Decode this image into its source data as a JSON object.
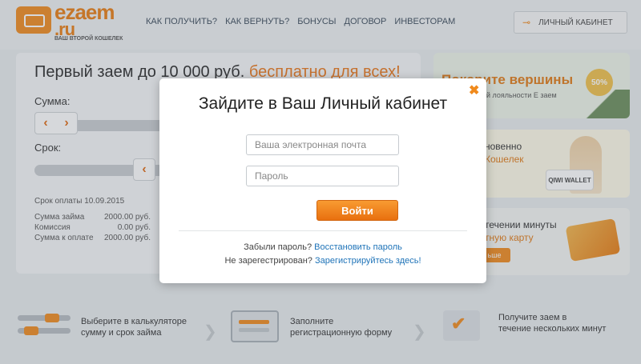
{
  "header": {
    "logo_name": "ezaem",
    "logo_tld": ".ru",
    "logo_tagline": "ВАШ ВТОРОЙ КОШЕЛЕК",
    "nav": [
      {
        "label": "КАК ПОЛУЧИТЬ?"
      },
      {
        "label": "КАК ВЕРНУТЬ?"
      },
      {
        "label": "БОНУСЫ"
      },
      {
        "label": "ДОГОВОР"
      },
      {
        "label": "ИНВЕСТОРАМ"
      }
    ],
    "cabinet_label": "ЛИЧНЫЙ КАБИНЕТ"
  },
  "calculator": {
    "title_main": "Первый заем до 10 000 руб.",
    "title_accent": "бесплатно для всех!",
    "sum_label": "Сумма:",
    "term_label": "Срок:",
    "due_date": "Срок оплаты 10.09.2015",
    "rows": [
      {
        "label": "Сумма займа",
        "value": "2000.00 руб."
      },
      {
        "label": "Комиссия",
        "value": "0.00 руб."
      },
      {
        "label": "Сумма к оплате",
        "value": "2000.00 руб."
      }
    ]
  },
  "promos": {
    "p1_title": "Покорите вершины",
    "p1_sub": "й лояльности Е заем",
    "p1_badge": "50%",
    "p2_line1": "новенно",
    "p2_line2": "Кошелек",
    "p2_logo": "QIWI WALLET",
    "p3_line1": "течении минуты",
    "p3_line2": "тную карту",
    "p3_button": "ьше"
  },
  "steps": [
    {
      "line1": "Выберите в калькуляторе",
      "line2": "сумму и срок займа"
    },
    {
      "line1": "Заполните",
      "line2": "регистрационную форму"
    },
    {
      "line1": "Получите заем в",
      "line2": "течение нескольких минут"
    }
  ],
  "modal": {
    "title": "Зайдите в Ваш Личный кабинет",
    "email_placeholder": "Ваша электронная почта",
    "password_placeholder": "Пароль",
    "login_button": "Войти",
    "forgot_text": "Забыли пароль?",
    "forgot_link": "Восстановить пароль",
    "register_text": "Не зарегестрирован?",
    "register_link": "Зарегистрируйтесь здесь!"
  },
  "colors": {
    "accent": "#f08a1c",
    "link": "#1e73b8"
  }
}
